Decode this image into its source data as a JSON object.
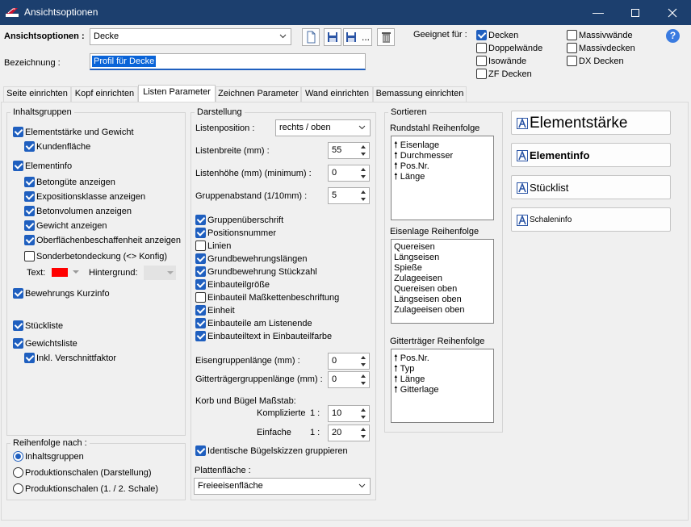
{
  "window": {
    "title": "Ansichtsoptionen"
  },
  "header": {
    "ansicht_label": "Ansichtsoptionen :",
    "ansicht_value": "Decke",
    "bez_label": "Bezeichnung :",
    "bez_value": "Profil für Decke",
    "suitable_label": "Geeignet für :",
    "suitable": {
      "decken": {
        "label": "Decken",
        "checked": true
      },
      "doppelwaende": {
        "label": "Doppelwände",
        "checked": false
      },
      "isowaende": {
        "label": "Isowände",
        "checked": false
      },
      "zfdecken": {
        "label": "ZF Decken",
        "checked": false
      },
      "massivwaende": {
        "label": "Massivwände",
        "checked": false
      },
      "massivdecken": {
        "label": "Massivdecken",
        "checked": false
      },
      "dxdecken": {
        "label": "DX Decken",
        "checked": false
      }
    },
    "help_glyph": "?",
    "saveas_glyph": "..."
  },
  "tabs": [
    "Seite einrichten",
    "Kopf einrichten",
    "Listen Parameter",
    "Zeichnen Parameter",
    "Wand einrichten",
    "Bemassung einrichten"
  ],
  "inhalt": {
    "title": "Inhaltsgruppen",
    "items": {
      "elementstaerke": {
        "label": "Elementstärke und Gewicht",
        "checked": true
      },
      "kundenflaeche": {
        "label": "Kundenfläche",
        "checked": true
      },
      "elementinfo": {
        "label": "Elementinfo",
        "checked": true
      },
      "betonguete": {
        "label": "Betongüte anzeigen",
        "checked": true
      },
      "exposition": {
        "label": "Expositionsklasse anzeigen",
        "checked": true
      },
      "betonvolumen": {
        "label": "Betonvolumen anzeigen",
        "checked": true
      },
      "gewicht": {
        "label": "Gewicht anzeigen",
        "checked": true
      },
      "oberflaeche": {
        "label": "Oberflächenbeschaffenheit anzeigen",
        "checked": true
      },
      "sonderbeton": {
        "label": "Sonderbetondeckung (<> Konfig)",
        "checked": false
      },
      "bewehrung": {
        "label": "Bewehrungs Kurzinfo",
        "checked": true
      },
      "stueckliste": {
        "label": "Stückliste",
        "checked": true
      },
      "gewichtsliste": {
        "label": "Gewichtsliste",
        "checked": true
      },
      "verschnitt": {
        "label": "Inkl. Verschnittfaktor",
        "checked": true
      }
    },
    "text_label": "Text:",
    "text_color": "#ff0000",
    "hintergrund_label": "Hintergrund:"
  },
  "reihenfolge": {
    "title": "Reihenfolge nach :",
    "options": [
      "Inhaltsgruppen",
      "Produktionschalen (Darstellung)",
      "Produktionschalen (1. / 2. Schale)"
    ],
    "selected": 0
  },
  "darstellung": {
    "title": "Darstellung",
    "listenposition_label": "Listenposition :",
    "listenposition_value": "rechts / oben",
    "listenbreite_label": "Listenbreite (mm) :",
    "listenbreite_value": "55",
    "listenhoehe_label": "Listenhöhe (mm) (minimum) :",
    "listenhoehe_value": "0",
    "gruppenabstand_label": "Gruppenabstand (1/10mm) :",
    "gruppenabstand_value": "5",
    "checks": {
      "gruppenueberschrift": {
        "label": "Gruppenüberschrift",
        "checked": true
      },
      "positionsnummer": {
        "label": "Positionsnummer",
        "checked": true
      },
      "linien": {
        "label": "Linien",
        "checked": false
      },
      "grundlaengen": {
        "label": "Grundbewehrungslängen",
        "checked": true
      },
      "grundstueckzahl": {
        "label": "Grundbewehrung Stückzahl",
        "checked": true
      },
      "einbauteilgroesse": {
        "label": "Einbauteilgröße",
        "checked": true
      },
      "massketten": {
        "label": "Einbauteil Maßkettenbeschriftung",
        "checked": false
      },
      "einheit": {
        "label": "Einheit",
        "checked": true
      },
      "listenende": {
        "label": "Einbauteile am Listenende",
        "checked": true
      },
      "einbauteilfarbe": {
        "label": "Einbauteiltext in Einbauteilfarbe",
        "checked": true
      },
      "buegelskizzen": {
        "label": "Identische Bügelskizzen gruppieren",
        "checked": true
      }
    },
    "eisengruppe_label": "Eisengruppenlänge (mm) :",
    "eisengruppe_value": "0",
    "gitter_label": "Gitterträgergruppenlänge (mm) :",
    "gitter_value": "0",
    "korb_label": "Korb und Bügel Maßstab:",
    "komplizierte_label": "Komplizierte",
    "komplizierte_prefix": "1 :",
    "komplizierte_value": "10",
    "einfache_label": "Einfache",
    "einfache_prefix": "1 :",
    "einfache_value": "20",
    "plattenflaeche_label": "Plattenfläche :",
    "plattenflaeche_value": "Freieeisenfläche"
  },
  "sortieren": {
    "title": "Sortieren",
    "rundstahl_title": "Rundstahl Reihenfolge",
    "rundstahl_items": [
      "Eisenlage",
      "Durchmesser",
      "Pos.Nr.",
      "Länge"
    ],
    "eisenlage_title": "Eisenlage Reihenfolge",
    "eisenlage_items": [
      "Quereisen",
      "Längseisen",
      "Spieße",
      "Zulageeisen",
      "Quereisen oben",
      "Längseisen oben",
      "Zulageeisen oben"
    ],
    "gitter_title": "Gitterträger Reihenfolge",
    "gitter_items": [
      "Pos.Nr.",
      "Typ",
      "Länge",
      "Gitterlage"
    ],
    "arrow_glyph": "🠕"
  },
  "styles": {
    "elementstaerke": "Elementstärke",
    "elementinfo": "Elementinfo",
    "stuecklist": "Stücklist",
    "schaleninfo": "Schaleninfo"
  },
  "colors": {
    "titlebar": "#1c3f6e",
    "accent": "#1f5fbf"
  }
}
